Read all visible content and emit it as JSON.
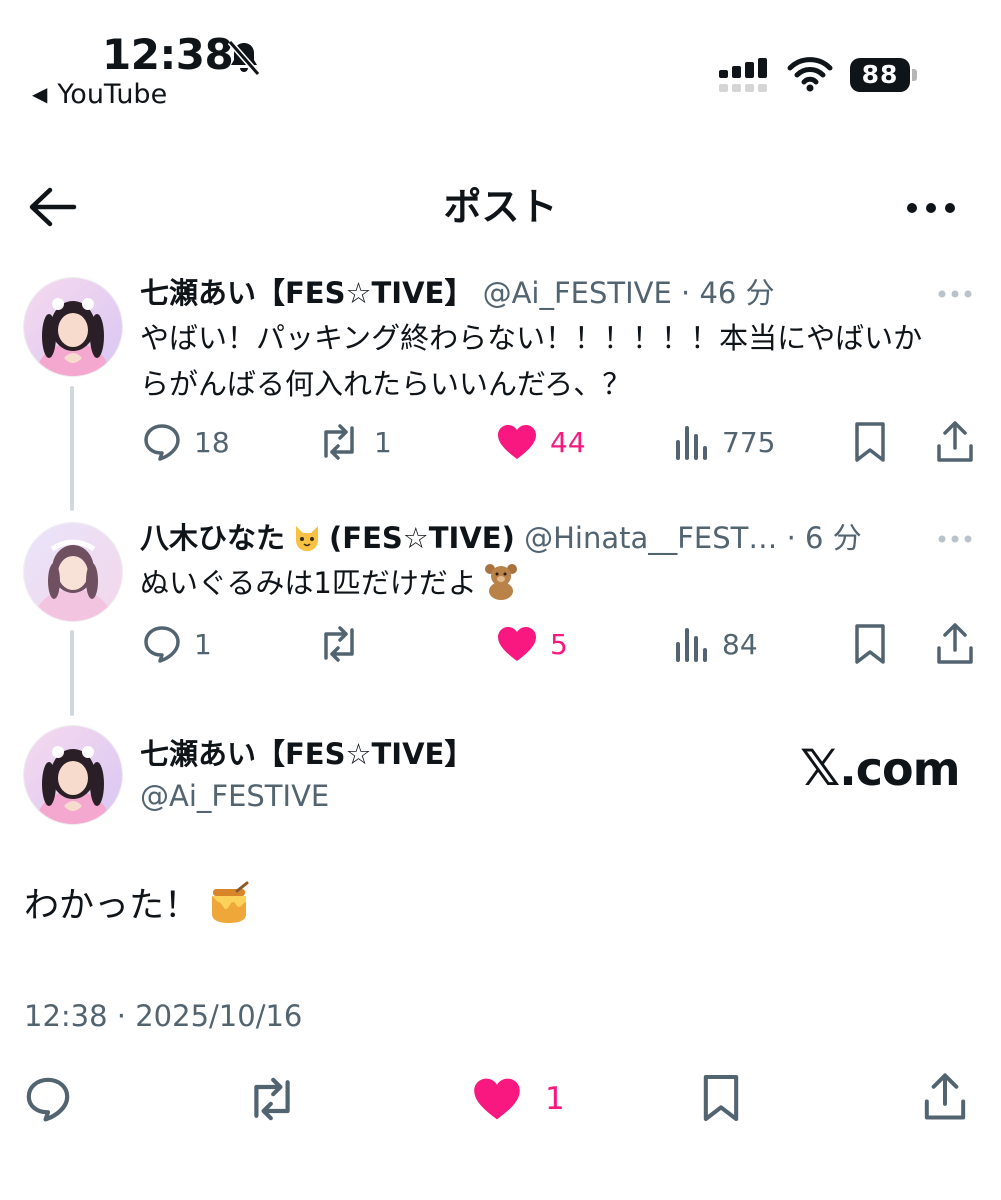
{
  "status_bar": {
    "time": "12:38",
    "back_app": "YouTube",
    "battery": "88"
  },
  "header": {
    "title": "ポスト"
  },
  "thread": [
    {
      "name": "七瀬あい【FES☆TIVE】",
      "handle": "@Ai_FESTIVE",
      "time": "· 46 分",
      "text_line1": "やばい！パッキング終わらない！！！！！！本当にやばいか",
      "text_line2": "らがんばる何入れたらいいんだろ、？",
      "replies": "18",
      "reposts": "1",
      "likes": "44",
      "views": "775"
    },
    {
      "name_prefix": "八木ひなた",
      "name_emoji": "cat-face",
      "name_suffix": "(FES☆TIVE)",
      "handle": "@Hinata__FEST…",
      "time": "· 6 分",
      "text": "ぬいぐるみは1匹だけだよ",
      "text_emoji": "teddy-bear",
      "replies": "1",
      "reposts": "",
      "likes": "5",
      "views": "84"
    }
  ],
  "main_post": {
    "name": "七瀬あい【FES☆TIVE】",
    "handle": "@Ai_FESTIVE",
    "text": "わかった！",
    "text_emoji": "honey-pot",
    "timestamp": "12:38 · 2025/10/16",
    "likes": "1"
  },
  "watermark": {
    "x_mark": "𝕏",
    "domain": ".com"
  },
  "colors": {
    "like_pink": "#f91880",
    "secondary_text": "#536471",
    "thread_line": "#cfd9de"
  }
}
